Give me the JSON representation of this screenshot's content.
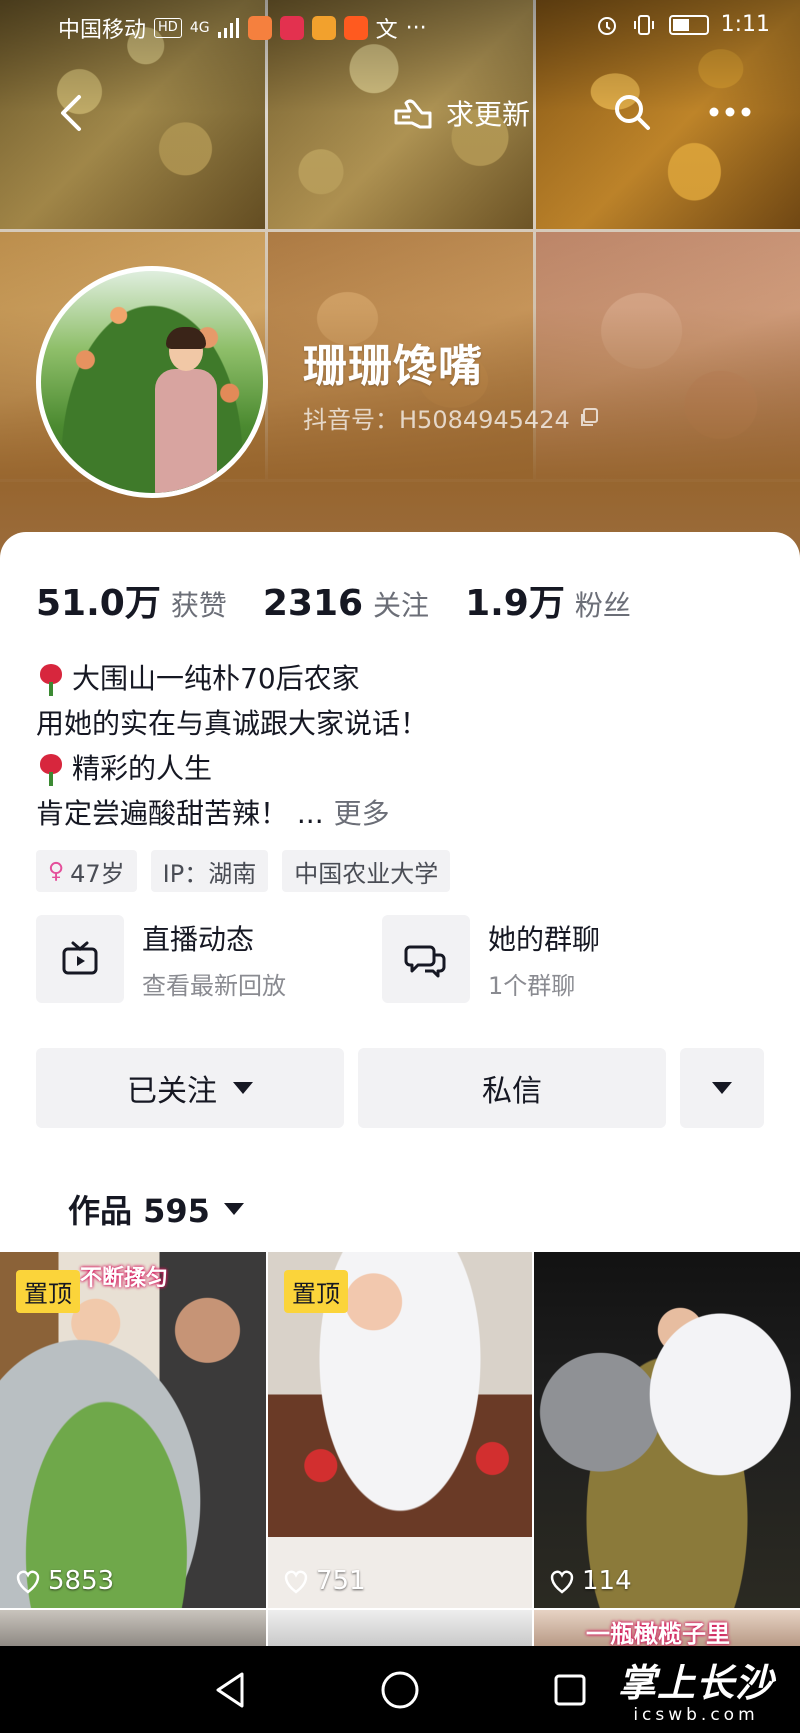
{
  "status_bar": {
    "carrier": "中国移动",
    "hd_badge": "HD",
    "network": "4G",
    "text_icon": "文",
    "overflow": "···",
    "time": "1:11",
    "icons": [
      "alarm-icon",
      "vibrate-icon",
      "battery-icon"
    ]
  },
  "header": {
    "request_update_label": "求更新",
    "icons": [
      "back-arrow-icon",
      "hand-point-icon",
      "search-icon",
      "more-dots-icon"
    ]
  },
  "profile": {
    "name": "珊珊馋嘴",
    "douyin_id": "抖音号：H5084945424"
  },
  "stats": [
    {
      "value": "51.0万",
      "label": "获赞"
    },
    {
      "value": "2316",
      "label": "关注"
    },
    {
      "value": "1.9万",
      "label": "粉丝"
    }
  ],
  "bio": {
    "line1": "大围山一纯朴70后农家",
    "line2": "用她的实在与真诚跟大家说话！",
    "line3": "精彩的人生",
    "line4": "肯定尝遍酸甜苦辣！ ...",
    "more": "更多"
  },
  "tags": {
    "age": "47岁",
    "ip": "IP：湖南",
    "school": "中国农业大学"
  },
  "cards": {
    "live": {
      "title": "直播动态",
      "subtitle": "查看最新回放"
    },
    "group": {
      "title": "她的群聊",
      "subtitle": "1个群聊"
    }
  },
  "actions": {
    "follow_label": "已关注",
    "message_label": "私信"
  },
  "works": {
    "label": "作品 595"
  },
  "videos": [
    {
      "pinned_label": "置顶",
      "likes": "5853",
      "caption": "不断揉匀"
    },
    {
      "pinned_label": "置顶",
      "likes": "751"
    },
    {
      "likes": "114"
    }
  ],
  "videos_row2": {
    "caption": "一瓶橄榄子里"
  },
  "watermark": {
    "main": "掌上长沙",
    "sub": "icswb.com"
  },
  "colors": {
    "banner_brown": "#9b6c3c",
    "pin_yellow": "#fbd43a",
    "text_primary": "#161823",
    "text_secondary": "#6b6e77",
    "chip_bg": "#f2f2f4",
    "rose_red": "#d7263d"
  }
}
